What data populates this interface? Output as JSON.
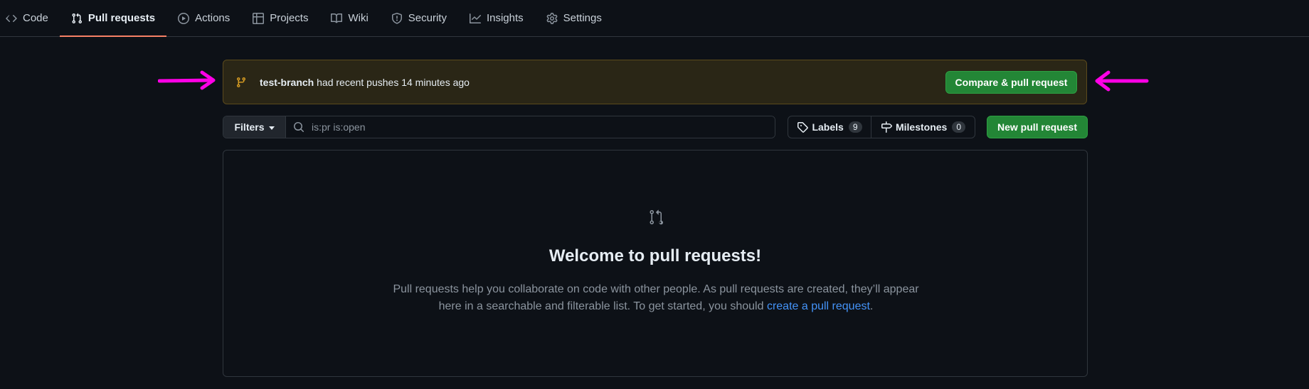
{
  "nav": {
    "tabs": [
      {
        "label": "Code",
        "icon": "code-icon"
      },
      {
        "label": "Pull requests",
        "icon": "git-pull-request-icon",
        "selected": true
      },
      {
        "label": "Actions",
        "icon": "play-icon"
      },
      {
        "label": "Projects",
        "icon": "table-icon"
      },
      {
        "label": "Wiki",
        "icon": "book-icon"
      },
      {
        "label": "Security",
        "icon": "shield-icon"
      },
      {
        "label": "Insights",
        "icon": "graph-icon"
      },
      {
        "label": "Settings",
        "icon": "gear-icon"
      }
    ]
  },
  "banner": {
    "branch": "test-branch",
    "message": "had recent pushes 14 minutes ago",
    "button": "Compare & pull request"
  },
  "filters": {
    "button": "Filters",
    "search_value": "is:pr is:open"
  },
  "labels": {
    "label": "Labels",
    "count": "9"
  },
  "milestones": {
    "label": "Milestones",
    "count": "0"
  },
  "new_pr_button": "New pull request",
  "blankslate": {
    "title": "Welcome to pull requests!",
    "description": "Pull requests help you collaborate on code with other people. As pull requests are created, they’ll appear here in a searchable and filterable list. To get started, you should",
    "link_text": "create a pull request",
    "suffix": "."
  },
  "colors": {
    "background": "#0d1117",
    "border": "#30363d",
    "accent_underline": "#f78166",
    "green_button": "#238636",
    "banner_bg": "#2a2616",
    "link": "#4493f8",
    "annotation_arrow": "#ff00e6"
  },
  "annotations": [
    "pink-arrow-pointing-right",
    "pink-arrow-pointing-left"
  ]
}
